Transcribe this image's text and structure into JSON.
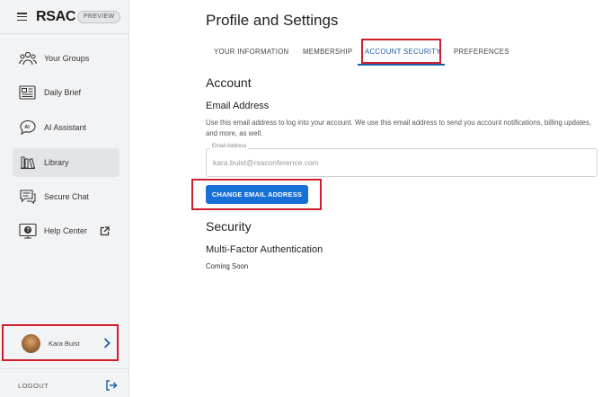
{
  "app": {
    "brand": "RSAC",
    "badge": "PREVIEW"
  },
  "sidebar": {
    "items": [
      {
        "label": "Your Groups",
        "icon": "groups-icon"
      },
      {
        "label": "Daily Brief",
        "icon": "newspaper-icon"
      },
      {
        "label": "AI Assistant",
        "icon": "ai-chat-icon"
      },
      {
        "label": "Library",
        "icon": "library-icon",
        "active": true
      },
      {
        "label": "Secure Chat",
        "icon": "chat-icon"
      },
      {
        "label": "Help Center",
        "icon": "help-icon",
        "external": true
      }
    ],
    "user": {
      "name": "Kara Buist"
    },
    "logout": "LOGOUT"
  },
  "main": {
    "title": "Profile and Settings",
    "tabs": [
      {
        "label": "YOUR INFORMATION"
      },
      {
        "label": "MEMBERSHIP"
      },
      {
        "label": "ACCOUNT SECURITY",
        "active": true
      },
      {
        "label": "PREFERENCES"
      }
    ],
    "account_heading": "Account",
    "email_heading": "Email Address",
    "email_description": "Use this email address to log into your account. We use this email address to send you account notifications, billing updates, and more, as well.",
    "email_field": {
      "label": "Email Address",
      "value": "kara.buist@rsaconference.com"
    },
    "change_email_button": "CHANGE EMAIL ADDRESS",
    "security_heading": "Security",
    "mfa_heading": "Multi-Factor Authentication",
    "mfa_status": "Coming Soon"
  },
  "colors": {
    "accent": "#1770d8",
    "tab_active": "#1a5fa8",
    "highlight": "#d01f2b",
    "sidebar_bg": "#f2f3f5"
  }
}
